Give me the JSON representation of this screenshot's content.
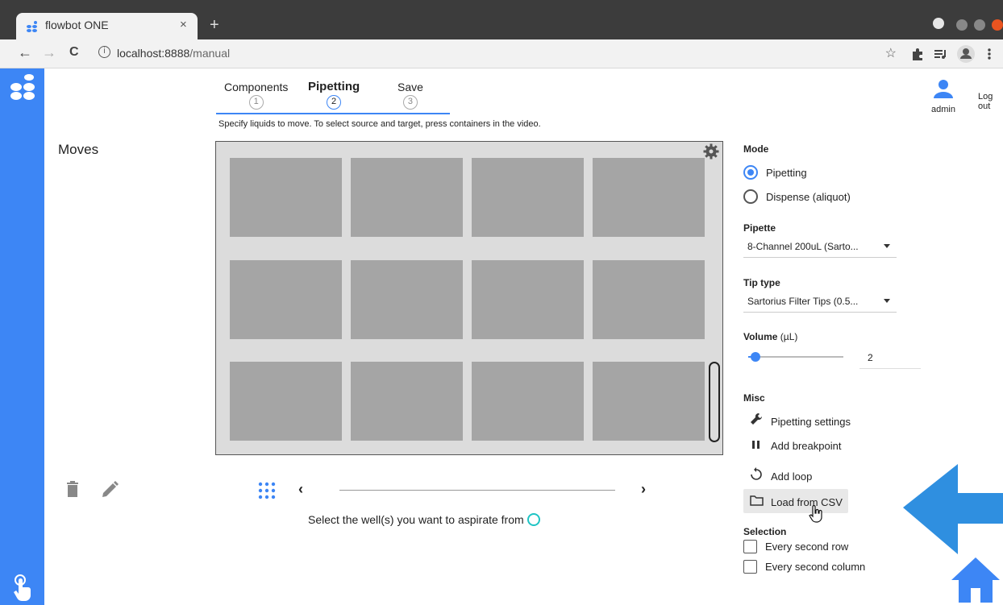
{
  "browser": {
    "tab_title": "flowbot ONE",
    "tab_close": "×",
    "new_tab": "+",
    "url": "localhost:8888/manual",
    "url_host": "localhost:8888",
    "url_path": "/manual",
    "back": "←",
    "forward": "→",
    "reload": "C",
    "info": "i",
    "star": "☆"
  },
  "app": {
    "stepper": [
      {
        "label": "Components",
        "num": "1"
      },
      {
        "label": "Pipetting",
        "num": "2"
      },
      {
        "label": "Save",
        "num": "3"
      }
    ],
    "instruction": "Specify liquids to move. To select source and target, press containers in the video.",
    "moves_title": "Moves",
    "user": "admin",
    "logout": "Log out",
    "select_message": "Select the well(s) you want to aspirate from",
    "nav_prev": "‹",
    "nav_next": "›"
  },
  "panel": {
    "mode_heading": "Mode",
    "mode_options": [
      "Pipetting",
      "Dispense (aliquot)"
    ],
    "mode_selected": "Pipetting",
    "pipette_heading": "Pipette",
    "pipette_value": "8-Channel 200uL (Sarto...",
    "tip_heading": "Tip type",
    "tip_value": "Sartorius Filter Tips (0.5...",
    "volume_heading": "Volume",
    "volume_unit": "(µL)",
    "volume_value": "2",
    "volume_fraction": 0.08,
    "misc_heading": "Misc",
    "misc_items": [
      "Pipetting settings",
      "Add breakpoint",
      "Add loop",
      "Load from CSV"
    ],
    "selection_heading": "Selection",
    "selection_items": [
      "Every second row",
      "Every second column"
    ]
  },
  "colors": {
    "accent": "#3d86f5",
    "arrow": "#2f8fe0",
    "cell": "#a5a5a5",
    "video_bg": "#dcdcdc"
  }
}
